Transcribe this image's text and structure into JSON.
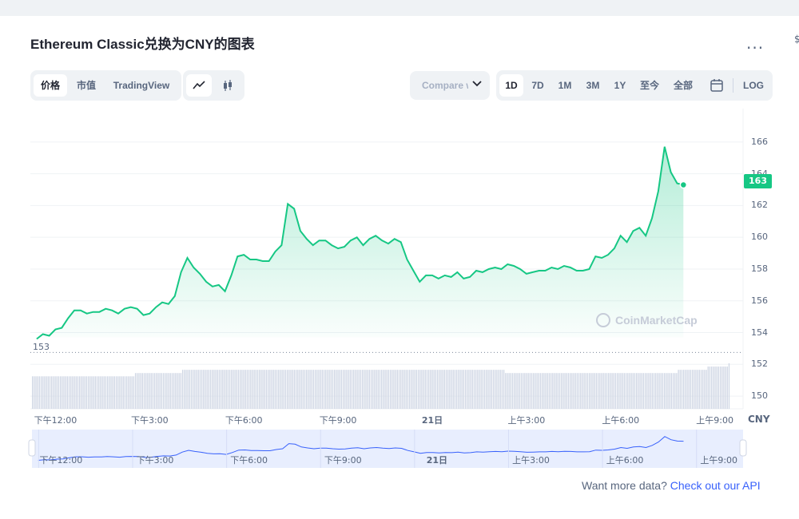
{
  "title": "Ethereum Classic兑换为CNY的图表",
  "more_label": "...",
  "edge_label": "$",
  "view_tabs": [
    {
      "label": "价格",
      "active": true
    },
    {
      "label": "市值",
      "active": false
    },
    {
      "label": "TradingView",
      "active": false
    }
  ],
  "chart_type_tabs": [
    {
      "icon": "line-chart-icon",
      "active": true
    },
    {
      "icon": "candlestick-icon",
      "active": false
    }
  ],
  "compare": {
    "label": "Compare with"
  },
  "range_tabs": [
    {
      "label": "1D",
      "active": true
    },
    {
      "label": "7D",
      "active": false
    },
    {
      "label": "1M",
      "active": false
    },
    {
      "label": "3M",
      "active": false
    },
    {
      "label": "1Y",
      "active": false
    },
    {
      "label": "至今",
      "active": false
    },
    {
      "label": "全部",
      "active": false
    },
    {
      "icon": "calendar-icon",
      "active": false
    },
    {
      "label": "LOG",
      "active": false
    }
  ],
  "watermark": "CoinMarketCap",
  "footer": {
    "text": "Want more data?",
    "link": "Check out our API"
  },
  "colors": {
    "line": "#16c784",
    "volume": "#cfd6e4",
    "navigator_line": "#3861fb",
    "navigator_fill": "#e8eefe"
  },
  "chart_data": {
    "type": "line",
    "title": "Ethereum Classic兑换为CNY的图表",
    "currency_label": "CNY",
    "ylim": [
      149.2,
      167.4
    ],
    "yticks": [
      "150",
      "152",
      "154",
      "156",
      "158",
      "160",
      "162",
      "164",
      "166"
    ],
    "y_label_min": "153",
    "y_last_label": "163",
    "grid": "horizontal",
    "x_ticks": [
      {
        "label": "下午12:00",
        "t": 12
      },
      {
        "label": "下午3:00",
        "t": 15
      },
      {
        "label": "下午6:00",
        "t": 18
      },
      {
        "label": "下午9:00",
        "t": 21
      },
      {
        "label": "21日",
        "t": 24
      },
      {
        "label": "上午3:00",
        "t": 27
      },
      {
        "label": "上午6:00",
        "t": 30
      },
      {
        "label": "上午9:00",
        "t": 33
      }
    ],
    "xlim": [
      11.2,
      33.9
    ],
    "series": [
      {
        "values": [
          [
            11.4,
            153.6
          ],
          [
            11.6,
            153.9
          ],
          [
            11.8,
            153.8
          ],
          [
            12.0,
            154.2
          ],
          [
            12.2,
            154.3
          ],
          [
            12.4,
            154.9
          ],
          [
            12.6,
            155.4
          ],
          [
            12.8,
            155.4
          ],
          [
            13.0,
            155.2
          ],
          [
            13.2,
            155.3
          ],
          [
            13.4,
            155.3
          ],
          [
            13.6,
            155.5
          ],
          [
            13.8,
            155.4
          ],
          [
            14.0,
            155.2
          ],
          [
            14.2,
            155.5
          ],
          [
            14.4,
            155.6
          ],
          [
            14.6,
            155.5
          ],
          [
            14.8,
            155.1
          ],
          [
            15.0,
            155.2
          ],
          [
            15.2,
            155.6
          ],
          [
            15.4,
            155.9
          ],
          [
            15.6,
            155.8
          ],
          [
            15.8,
            156.3
          ],
          [
            16.0,
            157.8
          ],
          [
            16.2,
            158.7
          ],
          [
            16.4,
            158.1
          ],
          [
            16.6,
            157.7
          ],
          [
            16.8,
            157.2
          ],
          [
            17.0,
            156.9
          ],
          [
            17.2,
            157.0
          ],
          [
            17.4,
            156.6
          ],
          [
            17.6,
            157.6
          ],
          [
            17.8,
            158.8
          ],
          [
            18.0,
            158.9
          ],
          [
            18.2,
            158.6
          ],
          [
            18.4,
            158.6
          ],
          [
            18.6,
            158.5
          ],
          [
            18.8,
            158.5
          ],
          [
            19.0,
            159.1
          ],
          [
            19.2,
            159.5
          ],
          [
            19.4,
            162.1
          ],
          [
            19.6,
            161.8
          ],
          [
            19.8,
            160.4
          ],
          [
            20.0,
            159.9
          ],
          [
            20.2,
            159.5
          ],
          [
            20.4,
            159.8
          ],
          [
            20.6,
            159.8
          ],
          [
            20.8,
            159.5
          ],
          [
            21.0,
            159.3
          ],
          [
            21.2,
            159.4
          ],
          [
            21.4,
            159.8
          ],
          [
            21.6,
            160.0
          ],
          [
            21.8,
            159.5
          ],
          [
            22.0,
            159.9
          ],
          [
            22.2,
            160.1
          ],
          [
            22.4,
            159.8
          ],
          [
            22.6,
            159.6
          ],
          [
            22.8,
            159.9
          ],
          [
            23.0,
            159.7
          ],
          [
            23.2,
            158.6
          ],
          [
            23.4,
            157.9
          ],
          [
            23.6,
            157.2
          ],
          [
            23.8,
            157.6
          ],
          [
            24.0,
            157.6
          ],
          [
            24.2,
            157.4
          ],
          [
            24.4,
            157.6
          ],
          [
            24.6,
            157.5
          ],
          [
            24.8,
            157.8
          ],
          [
            25.0,
            157.4
          ],
          [
            25.2,
            157.5
          ],
          [
            25.4,
            157.9
          ],
          [
            25.6,
            157.8
          ],
          [
            25.8,
            158.0
          ],
          [
            26.0,
            158.1
          ],
          [
            26.2,
            158.0
          ],
          [
            26.4,
            158.3
          ],
          [
            26.6,
            158.2
          ],
          [
            26.8,
            158.0
          ],
          [
            27.0,
            157.7
          ],
          [
            27.2,
            157.8
          ],
          [
            27.4,
            157.9
          ],
          [
            27.6,
            157.9
          ],
          [
            27.8,
            158.1
          ],
          [
            28.0,
            158.0
          ],
          [
            28.2,
            158.2
          ],
          [
            28.4,
            158.1
          ],
          [
            28.6,
            157.9
          ],
          [
            28.8,
            157.9
          ],
          [
            29.0,
            158.0
          ],
          [
            29.2,
            158.8
          ],
          [
            29.4,
            158.7
          ],
          [
            29.6,
            158.9
          ],
          [
            29.8,
            159.3
          ],
          [
            30.0,
            160.1
          ],
          [
            30.2,
            159.7
          ],
          [
            30.4,
            160.4
          ],
          [
            30.6,
            160.6
          ],
          [
            30.8,
            160.1
          ],
          [
            31.0,
            161.2
          ],
          [
            31.2,
            162.9
          ],
          [
            31.4,
            165.7
          ],
          [
            31.6,
            164.1
          ],
          [
            31.8,
            163.4
          ],
          [
            32.0,
            163.3
          ]
        ]
      }
    ],
    "volume": [
      10,
      10,
      10,
      10,
      10,
      10,
      10,
      10,
      10,
      10,
      10,
      10,
      10,
      10,
      10,
      10,
      10,
      10,
      10,
      10,
      10,
      10,
      10,
      10,
      10,
      10,
      10,
      10,
      10,
      10,
      10,
      10,
      10,
      10,
      10,
      10,
      10,
      10,
      10,
      10,
      10,
      10,
      10,
      10,
      10,
      10,
      10,
      10,
      10,
      10,
      10,
      10,
      10,
      10,
      10,
      10,
      10,
      10,
      10,
      11,
      11,
      11,
      11,
      11,
      11,
      11,
      11,
      11,
      11,
      11,
      11,
      11,
      11,
      11,
      11,
      11,
      11,
      11,
      11,
      11,
      11,
      11,
      11,
      11,
      11,
      11,
      12,
      12,
      12,
      12,
      12,
      12,
      12,
      12,
      12,
      12,
      12,
      12,
      12,
      12,
      12,
      12,
      12,
      12,
      12,
      12,
      12,
      12,
      12,
      12,
      12,
      12,
      12,
      12,
      12,
      12,
      12,
      12,
      12,
      12,
      12,
      12,
      12,
      12,
      12,
      12,
      12,
      12,
      12,
      12,
      12,
      12,
      12,
      12,
      12,
      12,
      12,
      12,
      12,
      12,
      12,
      12,
      12,
      12,
      12,
      12,
      12,
      12,
      12,
      12,
      12,
      12,
      12,
      12,
      12,
      12,
      12,
      12,
      12,
      12,
      12,
      12,
      12,
      12,
      12,
      12,
      12,
      12,
      12,
      12,
      12,
      12,
      12,
      12,
      12,
      12,
      12,
      12,
      12,
      12,
      12,
      12,
      12,
      12,
      12,
      12,
      12,
      12,
      12,
      12,
      12,
      12,
      12,
      12,
      12,
      12,
      12,
      12,
      12,
      12,
      12,
      12,
      12,
      12,
      12,
      12,
      12,
      12,
      12,
      12,
      12,
      12,
      12,
      12,
      12,
      12,
      12,
      12,
      12,
      12,
      12,
      12,
      12,
      12,
      12,
      12,
      12,
      12,
      12,
      12,
      12,
      12,
      12,
      12,
      12,
      12,
      12,
      12,
      12,
      12,
      12,
      12,
      12,
      12,
      12,
      12,
      12,
      12,
      12,
      12,
      12,
      12,
      12,
      12,
      12,
      12,
      12,
      12,
      12,
      12,
      12,
      12,
      12,
      12,
      12,
      12,
      12,
      12,
      12,
      12,
      12,
      11,
      11,
      11,
      11,
      11,
      11,
      11,
      11,
      11,
      11,
      11,
      11,
      11,
      11,
      11,
      11,
      11,
      11,
      11,
      11,
      11,
      11,
      11,
      11,
      11,
      11,
      11,
      11,
      11,
      11,
      11,
      11,
      11,
      11,
      11,
      11,
      11,
      11,
      11,
      11,
      11,
      11,
      11,
      11,
      11,
      11,
      11,
      11,
      11,
      11,
      11,
      11,
      11,
      11,
      11,
      11,
      11,
      11,
      11,
      11,
      11,
      11,
      11,
      11,
      11,
      11,
      11,
      11,
      11,
      11,
      11,
      11,
      11,
      11,
      11,
      11,
      11,
      11,
      11,
      11,
      11,
      11,
      11,
      11,
      11,
      11,
      11,
      11,
      11,
      11,
      11,
      11,
      11,
      11,
      11,
      11,
      11,
      11,
      11,
      12,
      12,
      12,
      12,
      12,
      12,
      12,
      12,
      12,
      12,
      12,
      12,
      12,
      12,
      12,
      12,
      12,
      13,
      13,
      13,
      13,
      13,
      13,
      13,
      13,
      13,
      13,
      13,
      13,
      14
    ],
    "navigator_ticks": [
      "下午12:00",
      "下午3:00",
      "下午6:00",
      "下午9:00",
      "21日",
      "上午3:00",
      "上午6:00",
      "上午9:00"
    ]
  }
}
